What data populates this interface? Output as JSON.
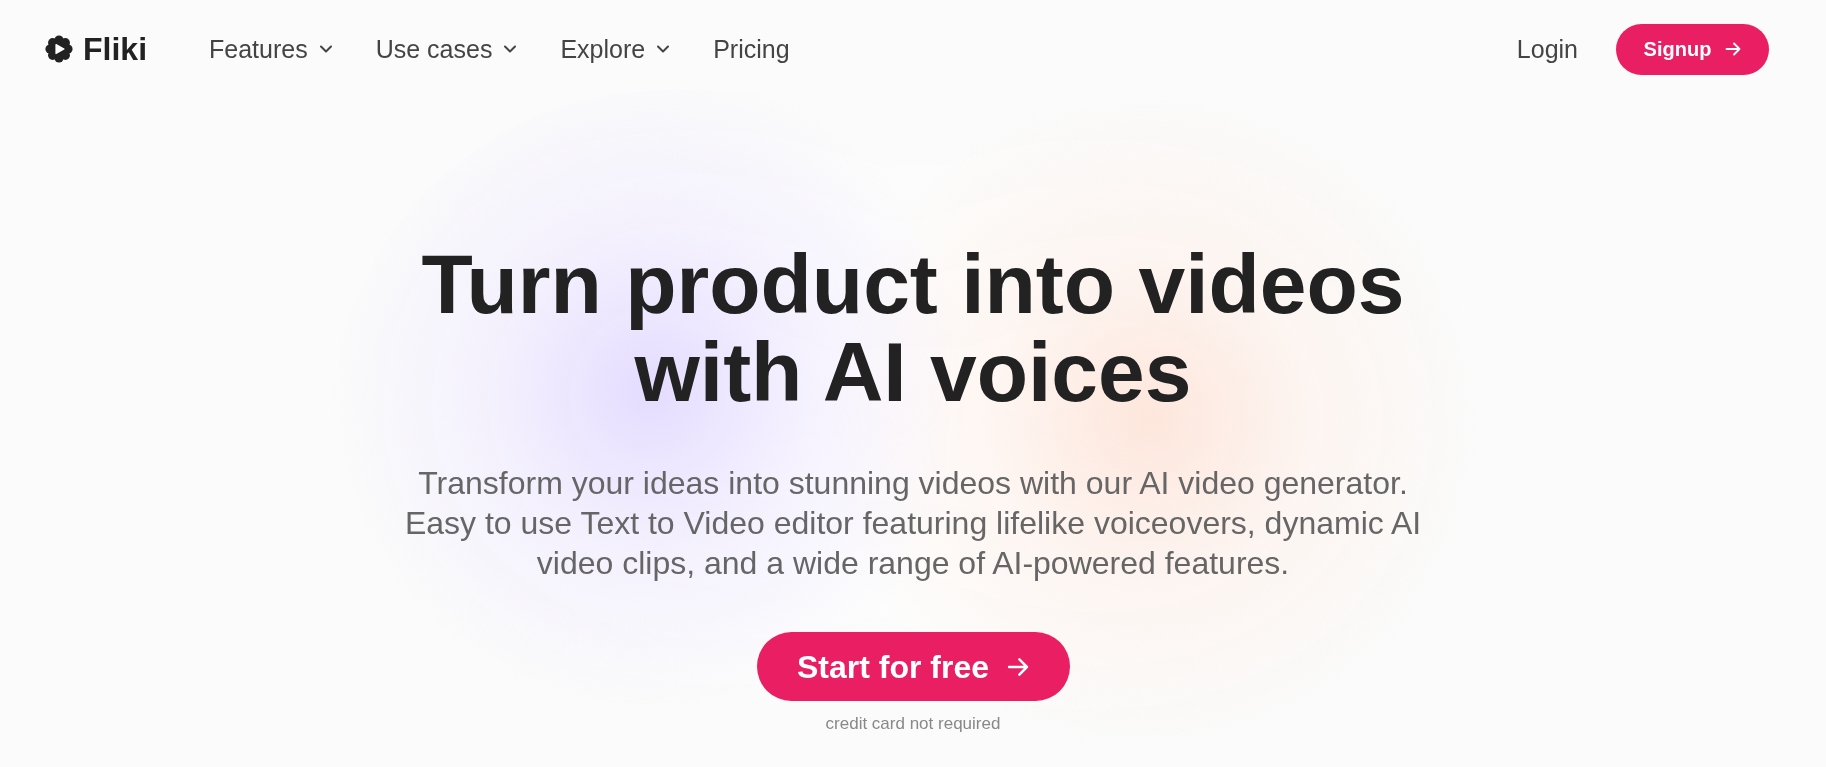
{
  "nav": {
    "logo": "Fliki",
    "items": [
      {
        "label": "Features",
        "kind": "dropdown"
      },
      {
        "label": "Use cases",
        "kind": "dropdown"
      },
      {
        "label": "Explore",
        "kind": "dropdown"
      },
      {
        "label": "Pricing",
        "kind": "link"
      }
    ],
    "login": "Login",
    "signup": "Signup"
  },
  "hero": {
    "title": "Turn product into videos with AI voices",
    "subtitle": "Transform your ideas into stunning videos with our AI video generator. Easy to use Text to Video editor featuring lifelike voiceovers, dynamic AI video clips, and a wide range of AI-powered features.",
    "cta": "Start for free",
    "note": "credit card not required"
  }
}
